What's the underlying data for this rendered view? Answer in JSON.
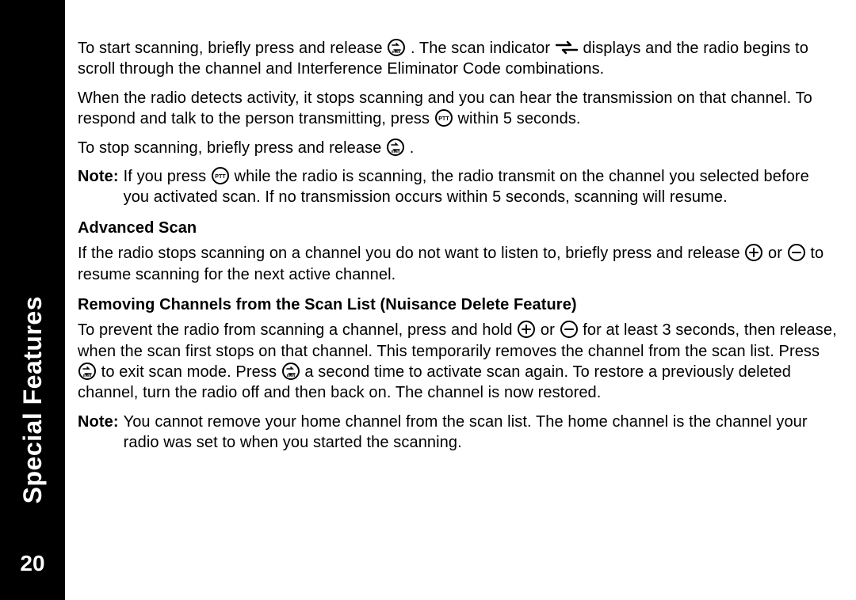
{
  "sidebar": {
    "section_title": "Special Features",
    "page_number": "20"
  },
  "body": {
    "p1a": "To start scanning, briefly press and release ",
    "p1b": ". The scan indicator ",
    "p1c": " displays and the radio begins to scroll through the channel and Interference Eliminator Code combinations.",
    "p2a": "When the radio detects activity, it stops scanning and you can hear the transmission on that channel. To respond and talk to the person transmitting, press ",
    "p2b": " within 5 seconds.",
    "p3a": "To stop scanning, briefly press and release ",
    "p3b": " .",
    "note1_label": "Note:",
    "note1a": " If you press ",
    "note1b": " while the radio is scanning, the radio transmit on the channel you selected before you activated scan. If no transmission occurs within 5 seconds, scanning will resume.",
    "h_adv": "Advanced Scan",
    "p4a": "If the radio stops scanning on a channel you do not want to listen to, briefly press and release ",
    "p4b": " or ",
    "p4c": " to resume scanning for the next active channel.",
    "h_remove": "Removing Channels from the Scan List (Nuisance Delete Feature)",
    "p5a": "To prevent the radio from scanning a channel, press and hold ",
    "p5b": " or ",
    "p5c": " for at least 3 seconds, then release, when the scan first stops on that channel. This temporarily removes the channel from the scan list. Press ",
    "p5d": " to exit scan mode. Press ",
    "p5e": " a second time to activate scan again. To restore a previously deleted channel, turn the radio off and then back on. The channel is now restored.",
    "note2_label": "Note:",
    "note2": " You cannot remove your home channel from the scan list. The home channel is the channel your radio was set to when you started the scanning."
  }
}
